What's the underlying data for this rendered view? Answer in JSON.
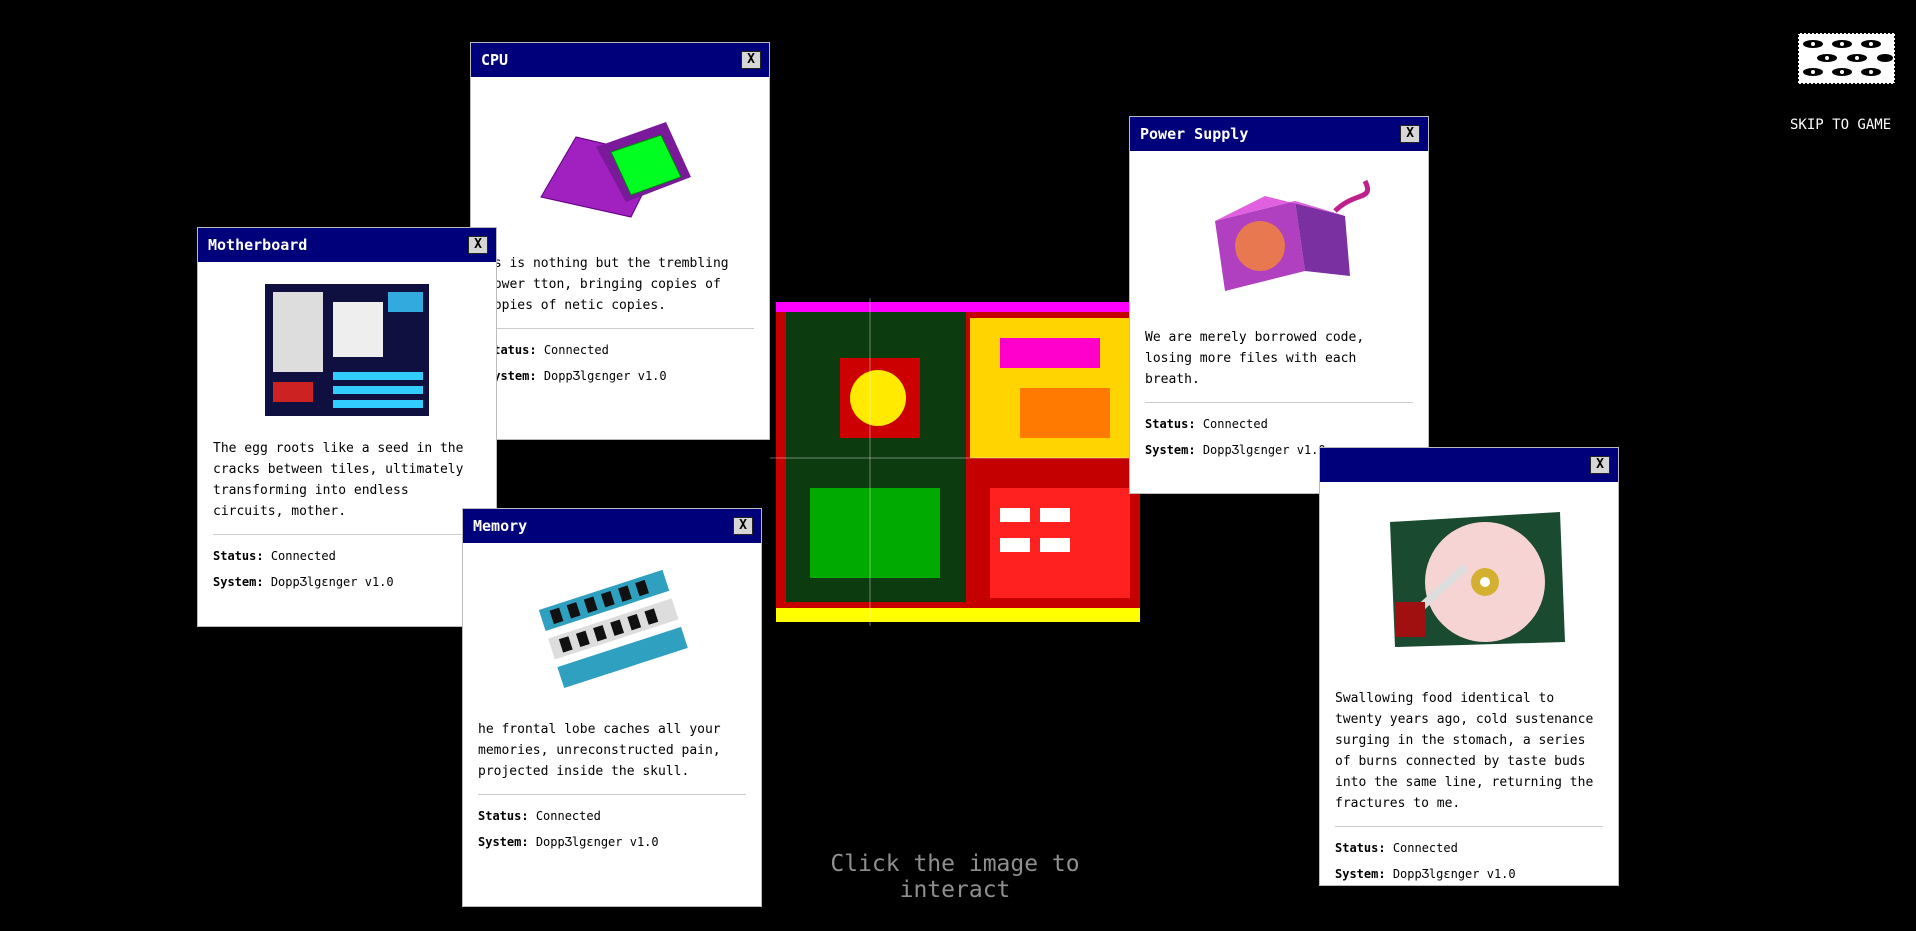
{
  "prompt": "Click the image to interact",
  "skip_label": "SKIP TO GAME",
  "status_label": "Status:",
  "system_label": "System:",
  "close_label": "X",
  "windows": {
    "cpu": {
      "title": "CPU",
      "description": "is is nothing but the trembling power tton, bringing copies of copies of netic copies.",
      "status": "Connected",
      "system": "DoppƷlgɛnger v1.0"
    },
    "motherboard": {
      "title": "Motherboard",
      "description": "The egg roots like a seed in the cracks between tiles, ultimately transforming into endless circuits, mother.",
      "status": "Connected",
      "system": "DoppƷlgɛnger v1.0"
    },
    "memory": {
      "title": "Memory",
      "description": "he frontal lobe caches all your memories, unreconstructed pain, projected inside the skull.",
      "status": "Connected",
      "system": "DoppƷlgɛnger v1.0"
    },
    "power": {
      "title": "Power Supply",
      "description": "We are merely borrowed code, losing more files with each breath.",
      "status": "Connected",
      "system": "DoppƷlgɛnger v1.0"
    },
    "harddrive": {
      "title": "",
      "description": "Swallowing food identical to twenty years ago, cold sustenance surging in the stomach, a series of burns connected by taste buds into the same line, returning the fractures to me.",
      "status": "Connected",
      "system": "DoppƷlgɛnger v1.0"
    }
  }
}
